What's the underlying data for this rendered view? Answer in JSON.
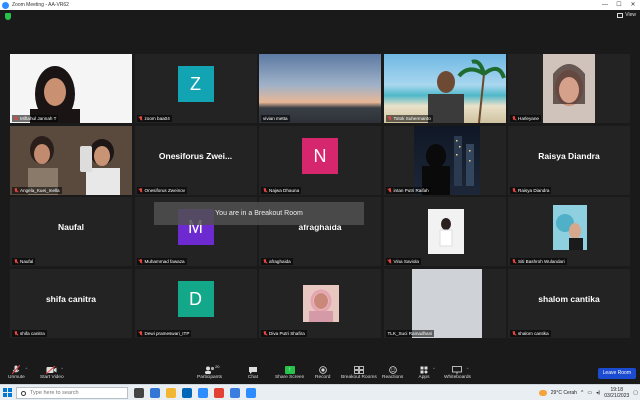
{
  "window": {
    "title": "Zoom Meeting - AA-VR62",
    "minimize": "—",
    "maximize": "☐",
    "close": "✕"
  },
  "topbar": {
    "view_label": "View"
  },
  "participants": [
    {
      "name": "Miftahul Jannah T",
      "muted": true,
      "kind": "video",
      "video_theme": "girl-hijab"
    },
    {
      "name": "zoom baa04",
      "muted": true,
      "kind": "letter",
      "letter": "Z",
      "color": "#13a4b3"
    },
    {
      "name": "vivian metta",
      "muted": false,
      "kind": "video",
      "video_theme": "sunset"
    },
    {
      "name": "Totok Suhermanto",
      "muted": true,
      "kind": "video",
      "video_theme": "beach",
      "active": true
    },
    {
      "name": "Harleyane",
      "muted": true,
      "kind": "video",
      "video_theme": "selfie"
    },
    {
      "name": "Angela_Kuei_Inella",
      "muted": true,
      "kind": "video",
      "video_theme": "two-people"
    },
    {
      "name": "Onesiforus Zweinov",
      "muted": true,
      "kind": "name",
      "display": "Onesiforus  Zwei..."
    },
    {
      "name": "Najwa Dhauna",
      "muted": true,
      "kind": "letter",
      "letter": "N",
      "color": "#d6276e"
    },
    {
      "name": "intan Putri Raifah",
      "muted": true,
      "kind": "video",
      "video_theme": "city-night"
    },
    {
      "name": "Raisya Diandra",
      "muted": true,
      "kind": "name",
      "display": "Raisya Diandra"
    },
    {
      "name": "Naufal",
      "muted": true,
      "kind": "name",
      "display": "Naufal"
    },
    {
      "name": "Muhammad fawaza",
      "muted": true,
      "kind": "letter",
      "letter": "M",
      "color": "#6d2ad1"
    },
    {
      "name": "afraghaida",
      "muted": true,
      "kind": "name",
      "display": "afraghaida"
    },
    {
      "name": "Vina Saviola",
      "muted": true,
      "kind": "video",
      "video_theme": "photo-white"
    },
    {
      "name": "Siti Bashroh Wulandari",
      "muted": true,
      "kind": "video",
      "video_theme": "photo-blue"
    },
    {
      "name": "shifa canitra",
      "muted": true,
      "kind": "name",
      "display": "shifa canitra"
    },
    {
      "name": "Dewi prameswari_ITP",
      "muted": true,
      "kind": "letter",
      "letter": "D",
      "color": "#14a88a"
    },
    {
      "name": "Diva Putri Shafira",
      "muted": true,
      "kind": "video",
      "video_theme": "photo-pink"
    },
    {
      "name": "TLK_Suci Ramadhani",
      "muted": false,
      "kind": "video",
      "video_theme": "gray"
    },
    {
      "name": "shalom cantika",
      "muted": true,
      "kind": "name",
      "display": "shalom cantika"
    }
  ],
  "breakout_message": "You are in a Breakout Room",
  "toolbar": {
    "unmute": "Unmute",
    "start_video": "Start Video",
    "participants": "Participants",
    "participants_count": "20",
    "chat": "Chat",
    "share_screen": "Share Screen",
    "record": "Record",
    "breakout_rooms": "Breakout Rooms",
    "reactions": "Reactions",
    "apps": "Apps",
    "whiteboards": "Whiteboards",
    "leave_room": "Leave Room"
  },
  "taskbar": {
    "search_placeholder": "Type here to search",
    "weather": "29°C  Cerah",
    "time": "19:18",
    "date": "03/21/2023"
  },
  "colors": {
    "active_speaker": "#b9e65a",
    "leave": "#1a4bd1",
    "share": "#27c24c"
  }
}
